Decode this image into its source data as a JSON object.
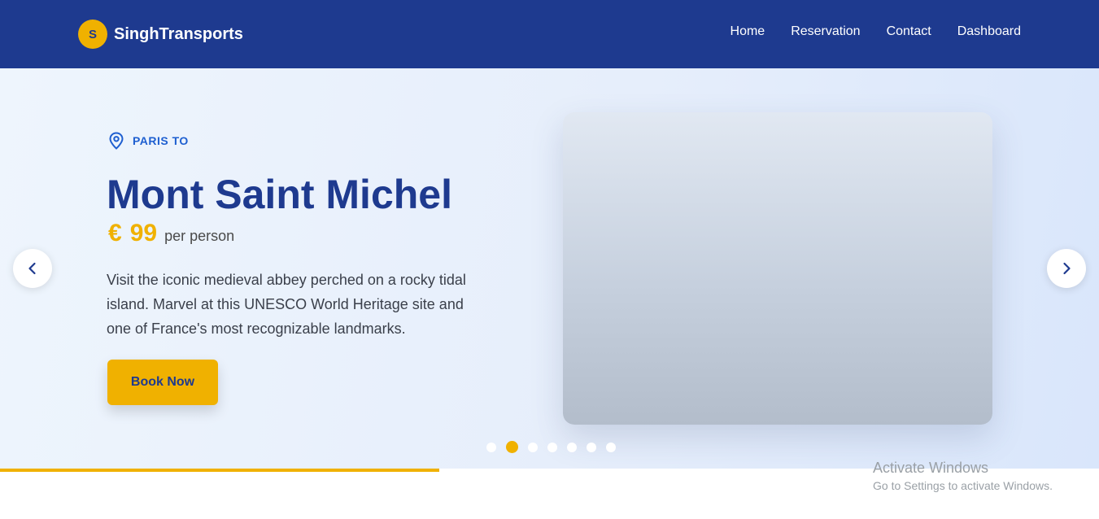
{
  "brand": {
    "logo_letter": "S",
    "name": "SinghTransports"
  },
  "nav": {
    "items": [
      "Home",
      "Reservation",
      "Contact",
      "Dashboard"
    ]
  },
  "hero": {
    "location_label": "PARIS TO",
    "destination": "Mont Saint Michel",
    "currency_symbol": "€",
    "price": "99",
    "price_unit": "per person",
    "description": "Visit the iconic medieval abbey perched on a rocky tidal island. Marvel at this UNESCO World Heritage site and one of France's most recognizable landmarks.",
    "cta_label": "Book Now"
  },
  "carousel": {
    "slide_count": 7,
    "active_index": 1,
    "progress": 0.4
  },
  "watermark": {
    "title": "Activate Windows",
    "subtitle": "Go to Settings to activate Windows."
  },
  "colors": {
    "navbar": "#1e3a8f",
    "accent": "#f0b100",
    "title": "#1e3a8f",
    "location": "#1e5fd0"
  },
  "icons": {
    "location": "map-pin-icon",
    "prev": "chevron-left-icon",
    "next": "chevron-right-icon"
  }
}
